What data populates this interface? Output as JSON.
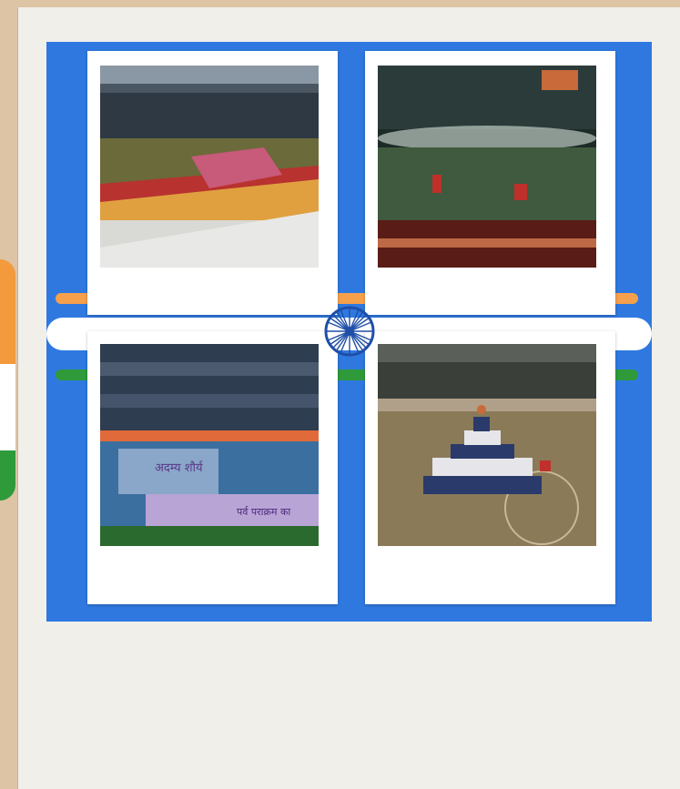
{
  "colors": {
    "frame": "#dcc4a4",
    "page": "#f1efea",
    "collage_blue": "#2f78e0",
    "saffron": "#f39a3c",
    "green": "#2e9a3a",
    "chakra": "#1f4fa8"
  },
  "photos": [
    {
      "id": "stadium-performers",
      "icon": "stadium-performance-photo"
    },
    {
      "id": "night-ceremony",
      "icon": "night-stadium-photo"
    },
    {
      "id": "crowd-stage",
      "icon": "crowd-stage-photo"
    },
    {
      "id": "human-pyramid",
      "icon": "human-pyramid-photo"
    }
  ],
  "banner": {
    "stage_text_1": "अदम्य शौर्य",
    "stage_text_2": "पर्व पराक्रम का"
  }
}
